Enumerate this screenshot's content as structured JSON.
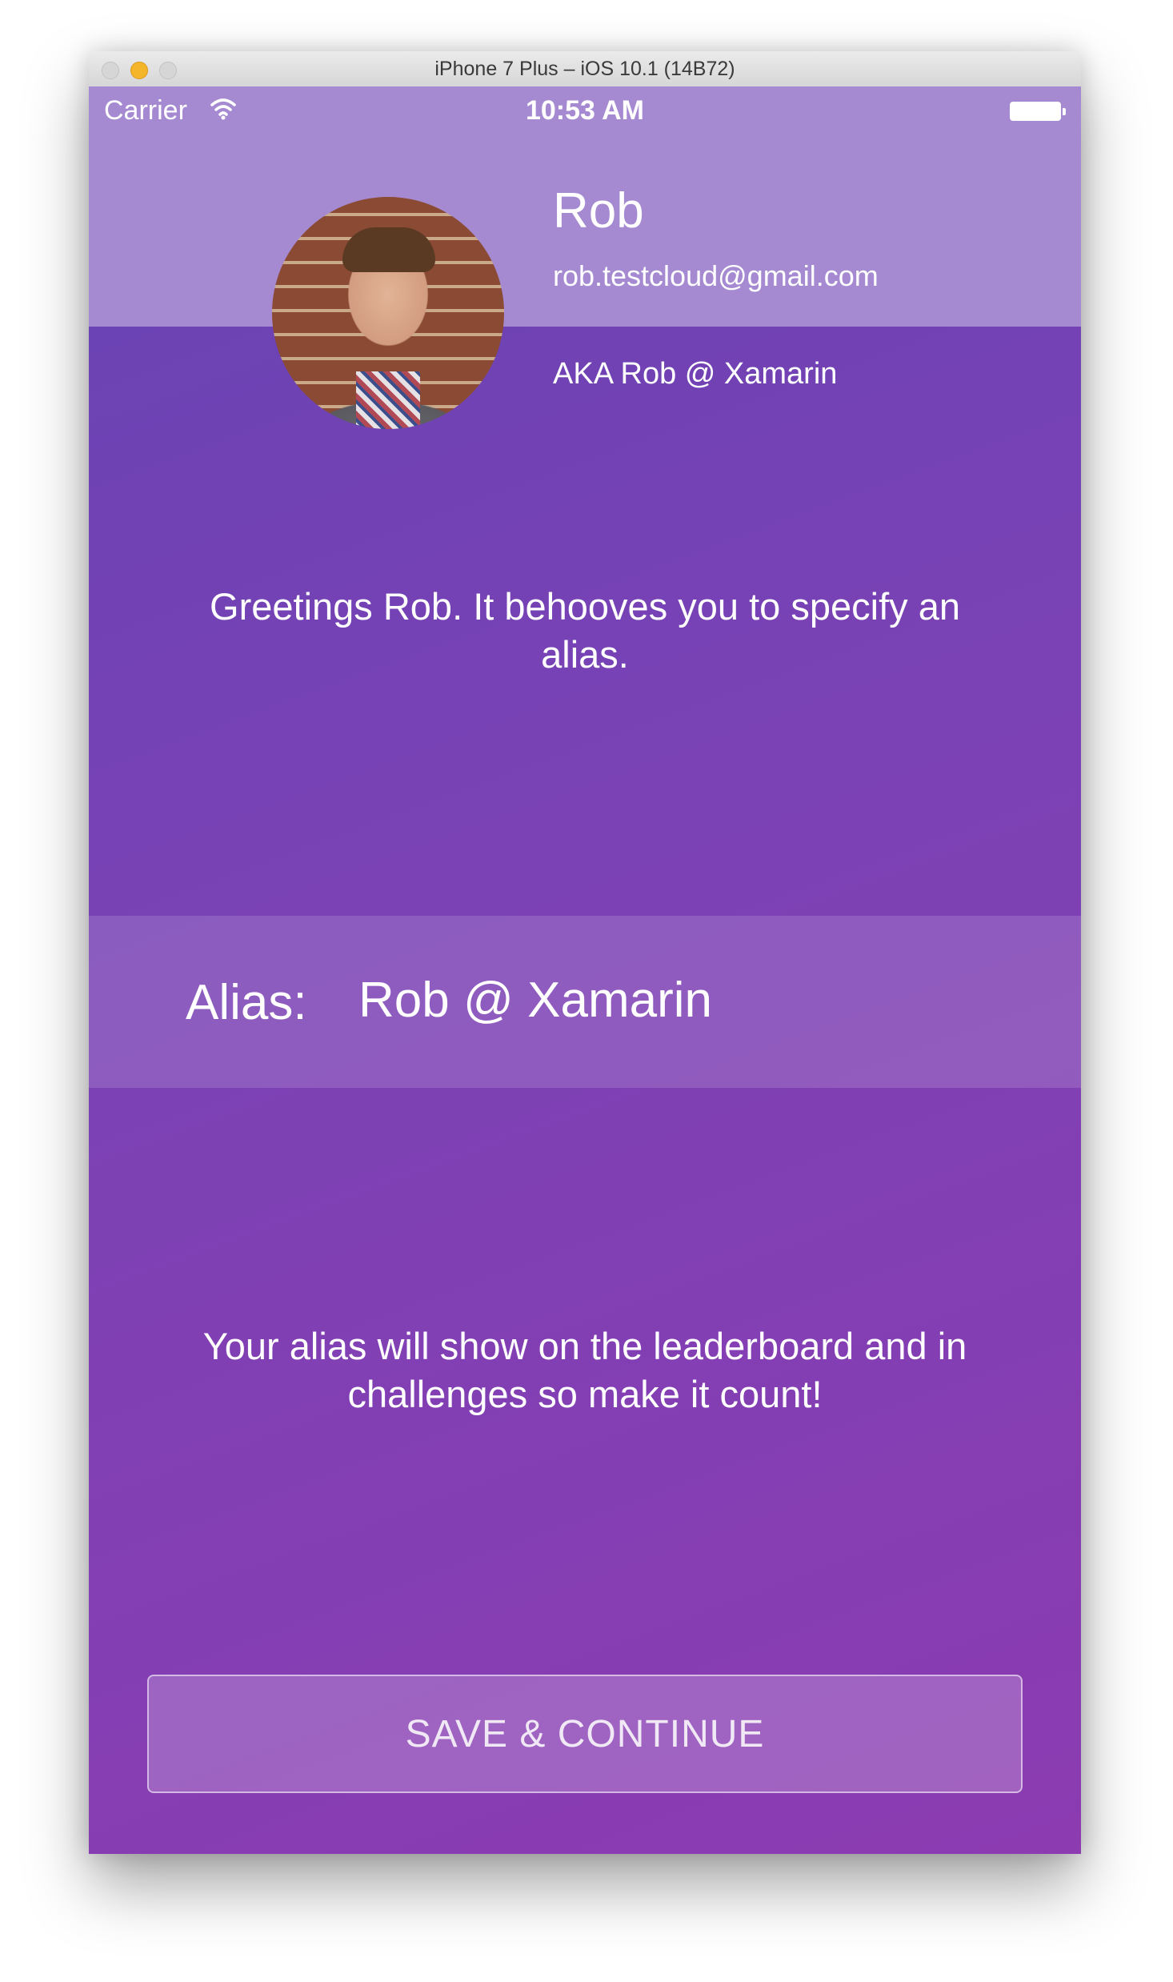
{
  "window": {
    "title": "iPhone 7 Plus – iOS 10.1 (14B72)"
  },
  "status_bar": {
    "carrier": "Carrier",
    "time": "10:53 AM",
    "icons": [
      "wifi-icon",
      "battery-icon"
    ]
  },
  "profile": {
    "name": "Rob",
    "email": "rob.testcloud@gmail.com",
    "aka": "AKA Rob @ Xamarin"
  },
  "greeting": "Greetings Rob. It behooves you to specify an alias.",
  "alias": {
    "label": "Alias:",
    "value": "Rob @ Xamarin"
  },
  "info": "Your alias will show on the leaderboard and in challenges so make it count!",
  "save_button": {
    "label": "SAVE & CONTINUE"
  },
  "colors": {
    "header": "#a58ad1",
    "gradient_start": "#6743b4",
    "gradient_end": "#8c3bb1",
    "text": "#ffffff"
  }
}
